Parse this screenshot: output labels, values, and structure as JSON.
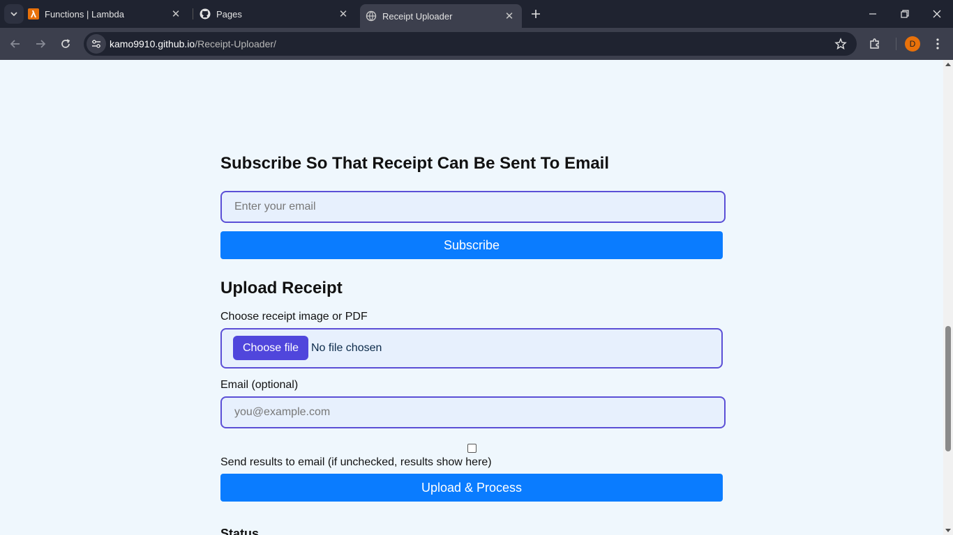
{
  "browser": {
    "tabs": [
      {
        "title": "Functions | Lambda",
        "active": false
      },
      {
        "title": "Pages",
        "active": false
      },
      {
        "title": "Receipt Uploader",
        "active": true
      }
    ],
    "url_host": "kamo9910.github.io",
    "url_path": "/Receipt-Uploader/",
    "profile_initial": "D"
  },
  "subscribe": {
    "heading": "Subscribe So That Receipt Can Be Sent To Email",
    "email_placeholder": "Enter your email",
    "button_label": "Subscribe"
  },
  "upload": {
    "heading": "Upload Receipt",
    "file_label": "Choose receipt image or PDF",
    "choose_label": "Choose file",
    "no_file_text": "No file chosen",
    "email_label": "Email (optional)",
    "email_placeholder": "you@example.com",
    "send_label": "Send results to email (if unchecked, results show here)",
    "button_label": "Upload & Process"
  },
  "status": {
    "heading": "Status"
  },
  "colors": {
    "accent": "#0a7cff",
    "field_border": "#5b4fd6",
    "file_button": "#5046dc",
    "page_bg": "#eff7fd"
  }
}
